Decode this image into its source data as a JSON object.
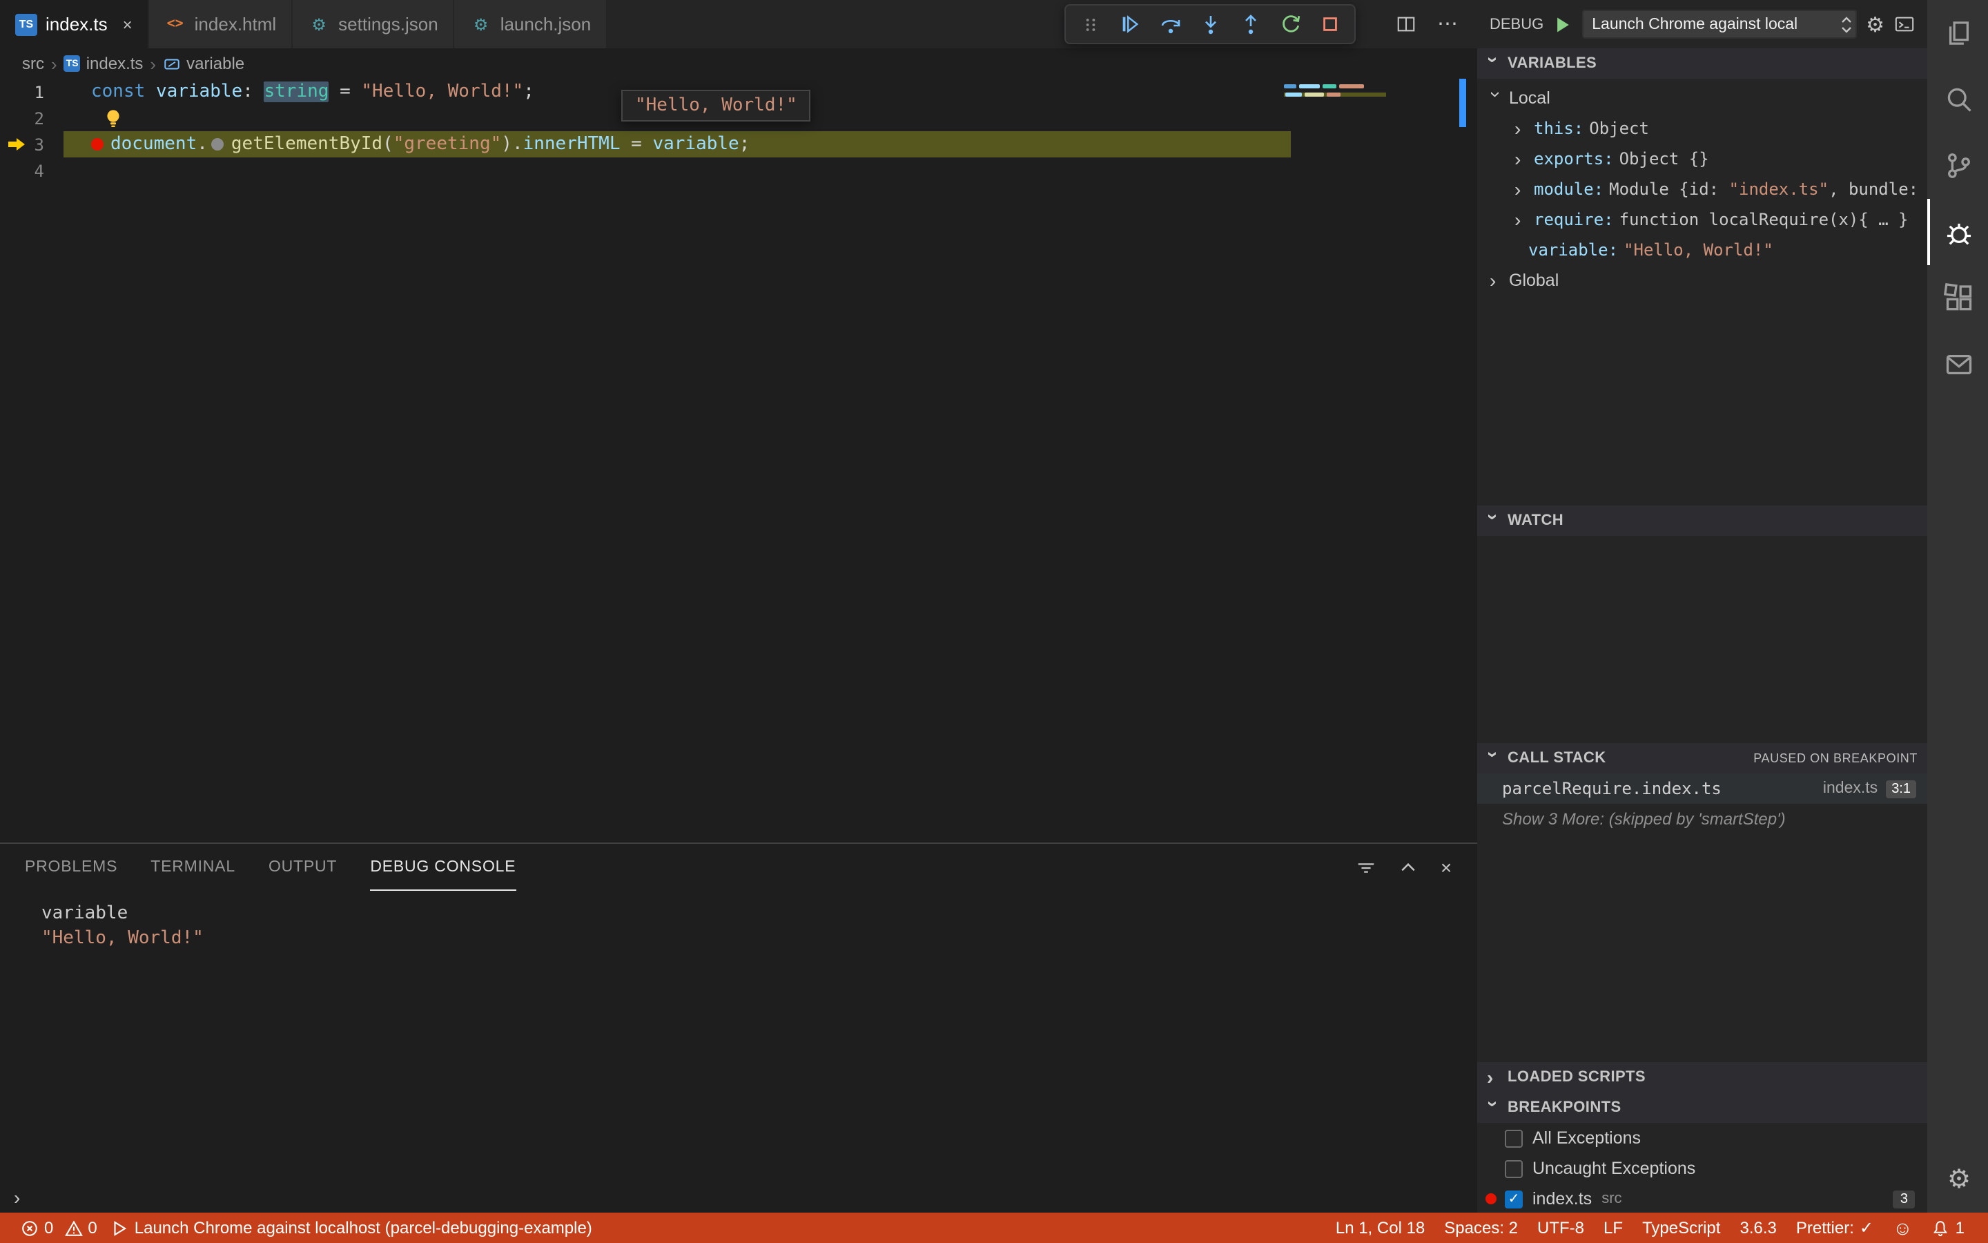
{
  "colors": {
    "statusbar_bg": "#c5401a",
    "stopped_line": "#55571f",
    "selection": "#44596b",
    "breakpoint_red": "#e51400",
    "debug_arrow_yellow": "#ffcc00",
    "string_orange": "#ce9178",
    "keyword_blue": "#569cd6",
    "type_teal": "#4ec9b0",
    "function_yellow": "#dcdcaa",
    "variable_blue": "#9cdcfe",
    "debug_icon_blue": "#75beff",
    "restart_green": "#89d185",
    "stop_red": "#f48771"
  },
  "tabs": [
    {
      "label": "index.ts",
      "icon": "TS",
      "active": true
    },
    {
      "label": "index.html",
      "icon": "<>",
      "active": false
    },
    {
      "label": "settings.json",
      "icon": "⚙",
      "active": false
    },
    {
      "label": "launch.json",
      "icon": "⚙",
      "active": false
    }
  ],
  "debug_toolbar": {
    "buttons": [
      "gripper-icon",
      "continue-icon",
      "step-over-icon",
      "step-into-icon",
      "step-out-icon",
      "restart-icon",
      "stop-icon"
    ]
  },
  "breadcrumb": {
    "items": [
      "src",
      "index.ts",
      "variable"
    ]
  },
  "editor": {
    "line_numbers": [
      "1",
      "2",
      "3",
      "4"
    ],
    "hover_value": "\"Hello, World!\"",
    "code": {
      "l1": {
        "c1": "const ",
        "c2": "variable",
        "c3": ": ",
        "c4": "string",
        "c5": " = ",
        "c6": "\"Hello, World!\"",
        "c7": ";"
      },
      "l3": {
        "c1": "document",
        "c2": ".",
        "c3": "getElementById",
        "c4": "(",
        "c5": "\"greeting\"",
        "c6": ")",
        "c7": ".",
        "c8": "innerHTML",
        "c9": " = ",
        "c10": "variable",
        "c11": ";"
      }
    }
  },
  "debug_controls": {
    "label": "DEBUG",
    "config": "Launch Chrome against local"
  },
  "sidebar": {
    "variables": {
      "title": "VARIABLES",
      "local": "Local",
      "global": "Global",
      "items": [
        {
          "name": "this:",
          "value": "Object"
        },
        {
          "name": "exports:",
          "value": "Object {}"
        },
        {
          "name": "module:",
          "value_p1": "Module {id: ",
          "value_p2": "\"index.ts\"",
          "value_p3": ", bundle: , …"
        },
        {
          "name": "require:",
          "value": "function localRequire(x){ … }"
        },
        {
          "name": "variable:",
          "value": "\"Hello, World!\""
        }
      ]
    },
    "watch": {
      "title": "WATCH"
    },
    "call_stack": {
      "title": "CALL STACK",
      "status": "PAUSED ON BREAKPOINT",
      "frame": {
        "name": "parcelRequire.index.ts",
        "file": "index.ts",
        "line": "3:1"
      },
      "more": "Show 3 More: (skipped by 'smartStep')"
    },
    "loaded_scripts": {
      "title": "LOADED SCRIPTS"
    },
    "breakpoints": {
      "title": "BREAKPOINTS",
      "items": [
        {
          "label": "All Exceptions",
          "checked": false
        },
        {
          "label": "Uncaught Exceptions",
          "checked": false
        },
        {
          "label": "index.ts",
          "detail": "src",
          "checked": true,
          "badge": "3",
          "check_glyph": "✓"
        }
      ]
    }
  },
  "panel": {
    "tabs": [
      "PROBLEMS",
      "TERMINAL",
      "OUTPUT",
      "DEBUG CONSOLE"
    ],
    "active": "DEBUG CONSOLE",
    "console": [
      {
        "text": "variable",
        "kind": "plain"
      },
      {
        "text": "\"Hello, World!\"",
        "kind": "string"
      }
    ]
  },
  "status_bar": {
    "errors": "0",
    "warnings": "0",
    "launch": "Launch Chrome against localhost (parcel-debugging-example)",
    "cursor": "Ln 1, Col 18",
    "indent": "Spaces: 2",
    "encoding": "UTF-8",
    "eol": "LF",
    "language": "TypeScript",
    "ts_version": "3.6.3",
    "prettier_label": "Prettier:",
    "prettier_check": "✓",
    "notifications": "1"
  }
}
